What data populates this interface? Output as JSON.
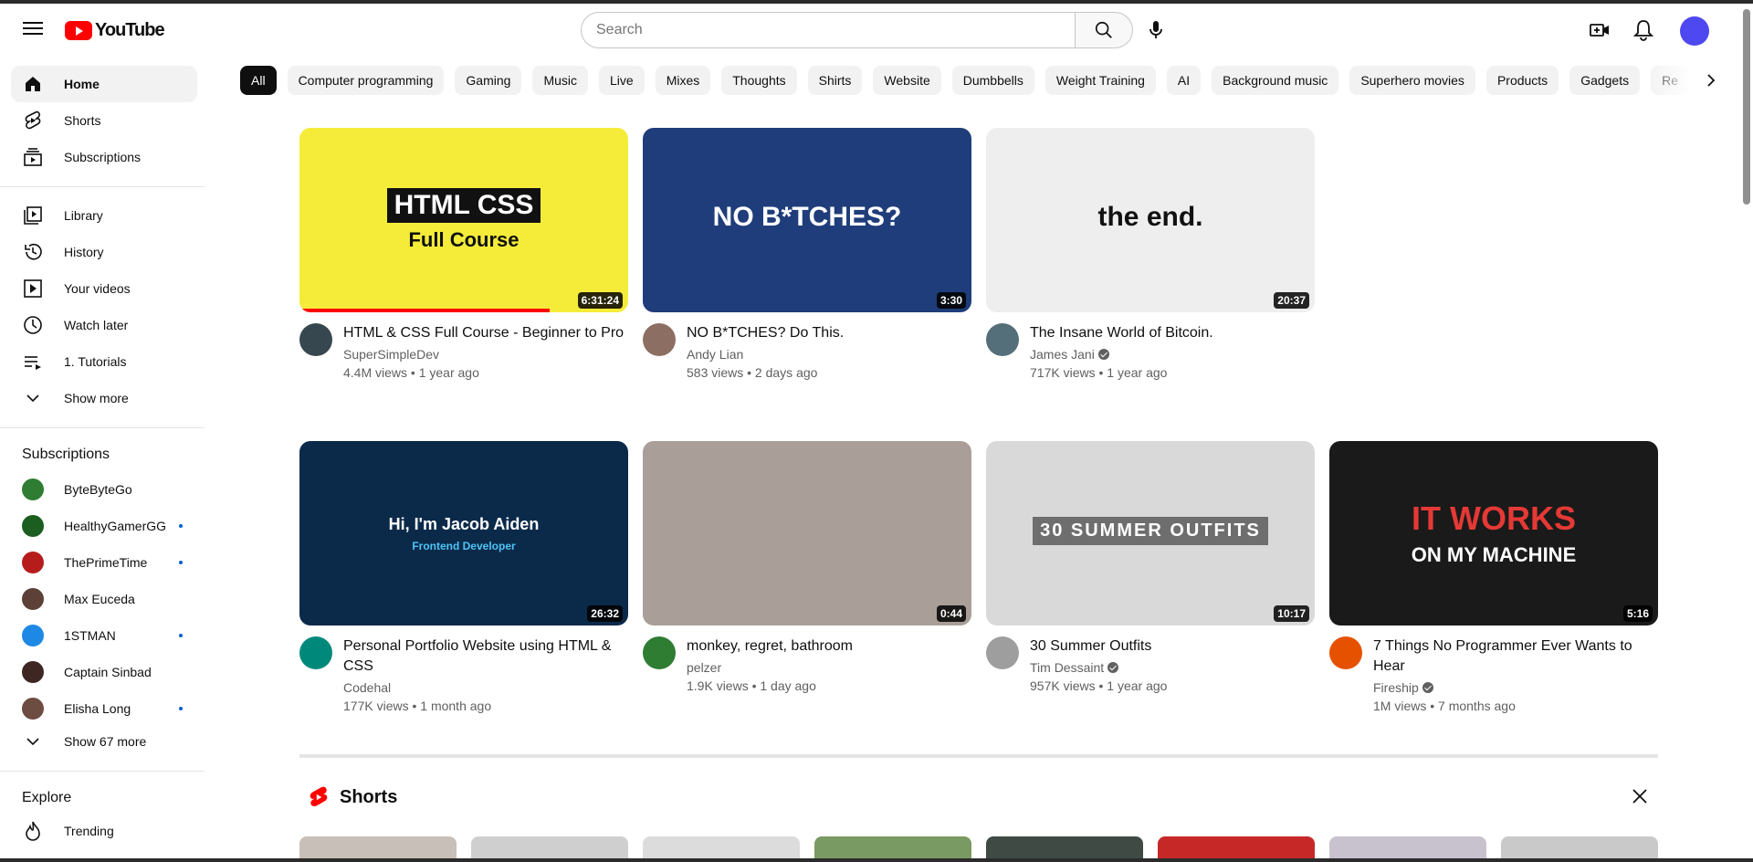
{
  "header": {
    "logo_text": "YouTube",
    "search_placeholder": "Search"
  },
  "sidebar": {
    "main": [
      {
        "label": "Home",
        "icon": "home-icon"
      },
      {
        "label": "Shorts",
        "icon": "shorts-icon"
      },
      {
        "label": "Subscriptions",
        "icon": "subscriptions-icon"
      }
    ],
    "library": [
      {
        "label": "Library",
        "icon": "library-icon"
      },
      {
        "label": "History",
        "icon": "history-icon"
      },
      {
        "label": "Your videos",
        "icon": "your-videos-icon"
      },
      {
        "label": "Watch later",
        "icon": "watch-later-icon"
      },
      {
        "label": "1. Tutorials",
        "icon": "playlist-icon"
      },
      {
        "label": "Show more",
        "icon": "chevron-down-icon"
      }
    ],
    "subscriptions_title": "Subscriptions",
    "subscriptions": [
      {
        "label": "ByteByteGo",
        "color": "#2e7d32",
        "new": false
      },
      {
        "label": "HealthyGamerGG",
        "color": "#1b5e20",
        "new": true
      },
      {
        "label": "ThePrimeTime",
        "color": "#b71c1c",
        "new": true
      },
      {
        "label": "Max Euceda",
        "color": "#5d4037",
        "new": false
      },
      {
        "label": "1STMAN",
        "color": "#1e88e5",
        "new": true
      },
      {
        "label": "Captain Sinbad",
        "color": "#3e2723",
        "new": false
      },
      {
        "label": "Elisha Long",
        "color": "#6d4c41",
        "new": true
      }
    ],
    "show_more_subs": "Show 67 more",
    "explore_title": "Explore",
    "explore": [
      {
        "label": "Trending",
        "icon": "trending-icon"
      }
    ]
  },
  "chips": [
    "All",
    "Computer programming",
    "Gaming",
    "Music",
    "Live",
    "Mixes",
    "Thoughts",
    "Shirts",
    "Website",
    "Dumbbells",
    "Weight Training",
    "AI",
    "Background music",
    "Superhero movies",
    "Products",
    "Gadgets",
    "Re"
  ],
  "videos": [
    {
      "title": "HTML & CSS Full Course - Beginner to Pro",
      "channel": "SuperSimpleDev",
      "verified": false,
      "stats": "4.4M views • 1 year ago",
      "duration": "6:31:24",
      "thumb_bg": "#f5ec3a",
      "thumb_text": "HTML CSS",
      "thumb_text2": "Full Course",
      "avatar": "#37474f",
      "progress": 0.76
    },
    {
      "title": "NO B*TCHES? Do This.",
      "channel": "Andy Lian",
      "verified": false,
      "stats": "583 views • 2 days ago",
      "duration": "3:30",
      "thumb_bg": "#1f3d7a",
      "thumb_text": "NO B*TCHES?",
      "thumb_text2": "",
      "avatar": "#8d6e63",
      "progress": 0
    },
    {
      "title": "The Insane World of Bitcoin.",
      "channel": "James Jani",
      "verified": true,
      "stats": "717K views • 1 year ago",
      "duration": "20:37",
      "thumb_bg": "#eeeeee",
      "thumb_text": "the end.",
      "thumb_text2": "",
      "avatar": "#546e7a",
      "progress": 0
    },
    {
      "title": "Personal Portfolio Website using HTML & CSS",
      "channel": "Codehal",
      "verified": false,
      "stats": "177K views • 1 month ago",
      "duration": "26:32",
      "thumb_bg": "#0b2a4a",
      "thumb_text": "Hi, I'm Jacob Aiden",
      "thumb_text2": "Frontend Developer",
      "avatar": "#00897b",
      "progress": 0
    },
    {
      "title": "monkey, regret, bathroom",
      "channel": "pelzer",
      "verified": false,
      "stats": "1.9K views • 1 day ago",
      "duration": "0:44",
      "thumb_bg": "#a99f98",
      "thumb_text": "",
      "thumb_text2": "",
      "avatar": "#2e7d32",
      "progress": 0
    },
    {
      "title": "30 Summer Outfits",
      "channel": "Tim Dessaint",
      "verified": true,
      "stats": "957K views • 1 year ago",
      "duration": "10:17",
      "thumb_bg": "#d9d9d9",
      "thumb_text": "30 SUMMER OUTFITS",
      "thumb_text2": "",
      "avatar": "#9e9e9e",
      "progress": 0
    },
    {
      "title": "7 Things No Programmer Ever Wants to Hear",
      "channel": "Fireship",
      "verified": true,
      "stats": "1M views • 7 months ago",
      "duration": "5:16",
      "thumb_bg": "#1a1a1a",
      "thumb_text": "IT WORKS",
      "thumb_text2": "ON MY MACHINE",
      "avatar": "#e65100",
      "progress": 0
    }
  ],
  "shorts": {
    "title": "Shorts",
    "thumb_colors": [
      "#c7bfb8",
      "#cfcfcf",
      "#dcdcdc",
      "#7a9a63",
      "#3f4a44",
      "#c62828",
      "#c8c2cf",
      "#c9c9c9"
    ]
  }
}
